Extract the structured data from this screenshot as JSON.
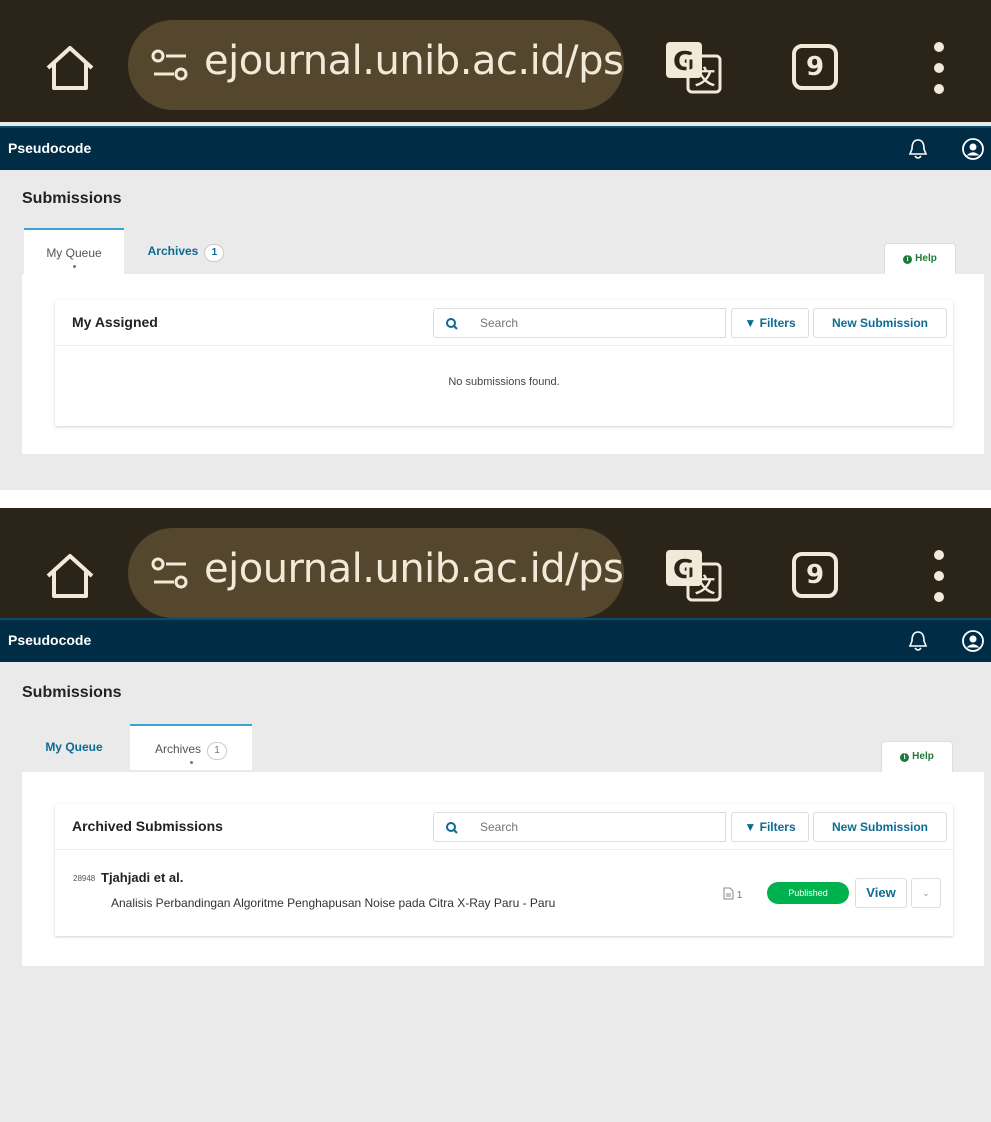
{
  "browser": {
    "url": "ejournal.unib.ac.id/psı",
    "tab_count": "9",
    "colors": {
      "bar": "#2b2418",
      "pill": "#54472d",
      "text": "#f2ead9"
    }
  },
  "app": {
    "name": "Pseudocode",
    "header_color": "#002c45"
  },
  "page": {
    "title": "Submissions"
  },
  "tabs": {
    "my_queue": "My Queue",
    "archives": "Archives",
    "archives_count": "1"
  },
  "help": {
    "label": "Help"
  },
  "search": {
    "placeholder": "Search"
  },
  "toolbar": {
    "filters_label": "Filters",
    "new_submission_label": "New Submission"
  },
  "queue_view": {
    "list_title": "My Assigned",
    "empty_message": "No submissions found."
  },
  "archive_view": {
    "list_title": "Archived Submissions",
    "submissions": [
      {
        "id": "28948",
        "authors": "Tjahjadi et al.",
        "title": "Analisis Perbandingan Algoritme Penghapusan Noise pada Citra X-Ray Paru - Paru",
        "files": "1",
        "status": "Published",
        "action": "View"
      }
    ],
    "status_color": "#00b24e"
  }
}
